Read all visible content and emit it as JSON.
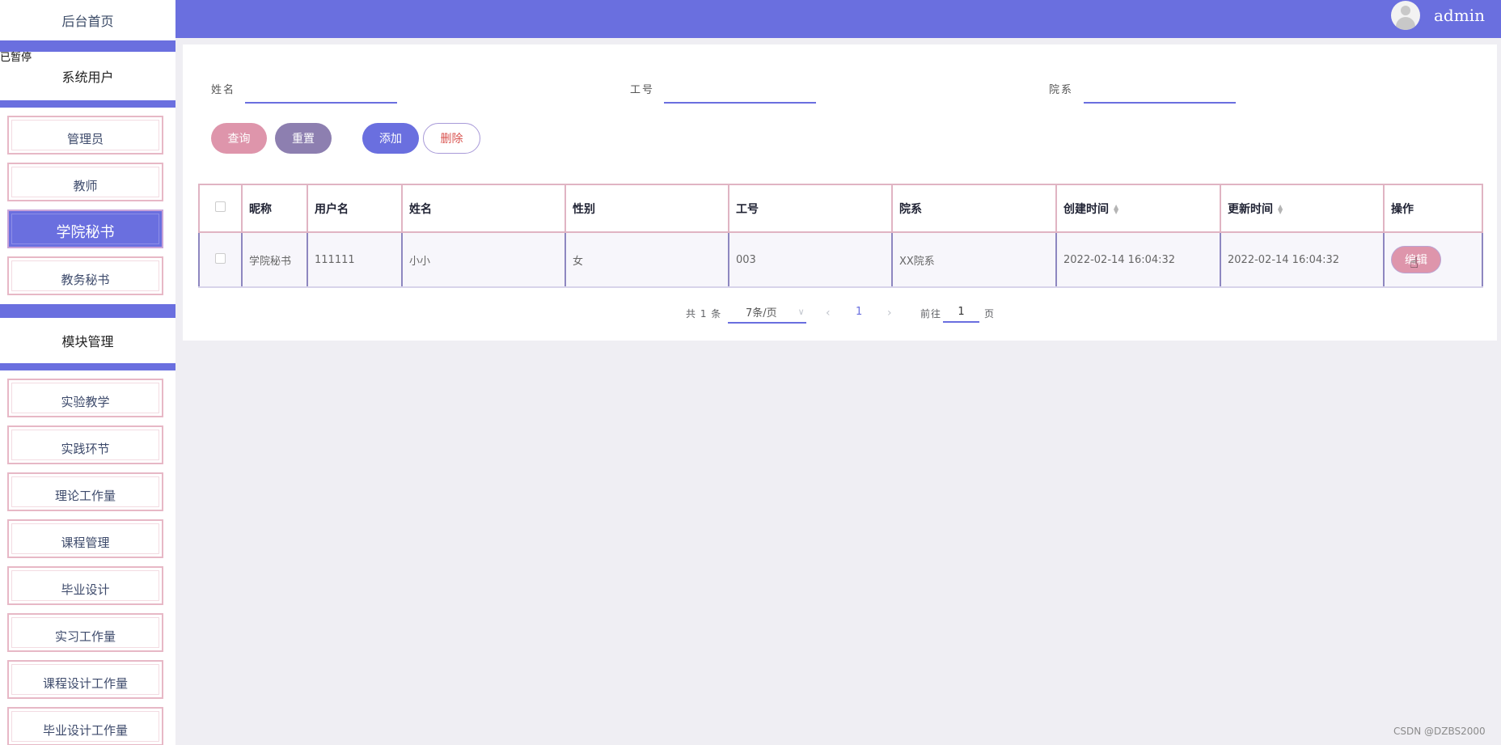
{
  "sidebar": {
    "home": "后台首页",
    "paused_overlay": "已暂停",
    "sections": [
      {
        "title": "系统用户",
        "items": [
          "管理员",
          "教师",
          "学院秘书",
          "教务秘书"
        ]
      },
      {
        "title": "模块管理",
        "items": [
          "实验教学",
          "实践环节",
          "理论工作量",
          "课程管理",
          "毕业设计",
          "实习工作量",
          "课程设计工作量",
          "毕业设计工作量"
        ]
      }
    ],
    "active_item": "学院秘书"
  },
  "header": {
    "username": "admin",
    "avatar_icon": "user-avatar-icon",
    "color": "#6a6fdf"
  },
  "search": {
    "name_label": "姓名",
    "job_no_label": "工号",
    "dept_label": "院系",
    "name_value": "",
    "job_no_value": "",
    "dept_value": ""
  },
  "actions": {
    "query": "查询",
    "reset": "重置",
    "add": "添加",
    "delete": "删除"
  },
  "table": {
    "columns": [
      "昵称",
      "用户名",
      "姓名",
      "性别",
      "工号",
      "院系",
      "创建时间",
      "更新时间",
      "操作"
    ],
    "sortable": [
      "创建时间",
      "更新时间"
    ],
    "rows": [
      {
        "nickname": "学院秘书",
        "username": "111111",
        "name": "小小",
        "gender": "女",
        "job_no": "003",
        "dept": "XX院系",
        "created": "2022-02-14 16:04:32",
        "updated": "2022-02-14 16:04:32",
        "edit": "编辑"
      }
    ]
  },
  "pagination": {
    "total_text": "共 1 条",
    "page_size": "7条/页",
    "current_page": "1",
    "goto_prefix": "前往",
    "goto_value": "1",
    "goto_suffix": "页"
  },
  "watermark": "CSDN @DZBS2000"
}
